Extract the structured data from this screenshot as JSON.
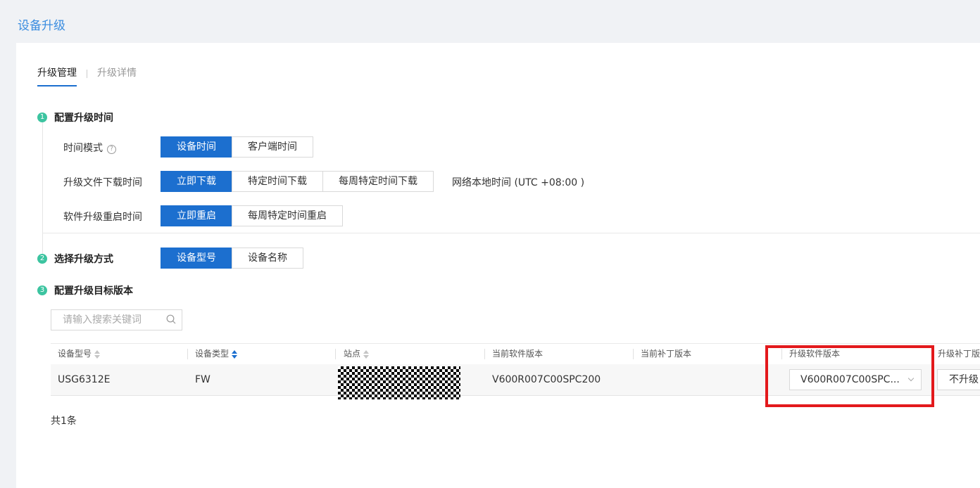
{
  "page_title": "设备升级",
  "tabs": [
    {
      "label": "升级管理",
      "active": true
    },
    {
      "label": "升级详情",
      "active": false
    }
  ],
  "steps": [
    {
      "number": "1",
      "title": "配置升级时间"
    },
    {
      "number": "2",
      "title": "选择升级方式"
    },
    {
      "number": "3",
      "title": "配置升级目标版本"
    }
  ],
  "time_mode": {
    "label": "时间模式",
    "help_icon": "?",
    "options": [
      "设备时间",
      "客户端时间"
    ],
    "selected": "设备时间"
  },
  "download_time": {
    "label": "升级文件下载时间",
    "options": [
      "立即下载",
      "特定时间下载",
      "每周特定时间下载"
    ],
    "selected": "立即下载",
    "timezone_note": "网络本地时间 (UTC +08:00 )"
  },
  "restart_time": {
    "label": "软件升级重启时间",
    "options": [
      "立即重启",
      "每周特定时间重启"
    ],
    "selected": "立即重启"
  },
  "upgrade_method": {
    "options": [
      "设备型号",
      "设备名称"
    ],
    "selected": "设备型号"
  },
  "search": {
    "placeholder": "请输入搜索关键词",
    "value": ""
  },
  "table": {
    "columns": [
      "设备型号",
      "设备类型",
      "站点",
      "当前软件版本",
      "当前补丁版本",
      "升级软件版本",
      "升级补丁版"
    ],
    "rows": [
      {
        "model": "USG6312E",
        "type": "FW",
        "site": "",
        "current_software": "V600R007C00SPC200",
        "current_patch": "",
        "upgrade_software": "V600R007C00SPC...",
        "upgrade_patch": "不升级"
      }
    ]
  },
  "total": "共1条",
  "colors": {
    "accent": "#1c6fcf",
    "step": "#3cc4a0",
    "highlight": "#e3191c",
    "title": "#3b8de0"
  }
}
